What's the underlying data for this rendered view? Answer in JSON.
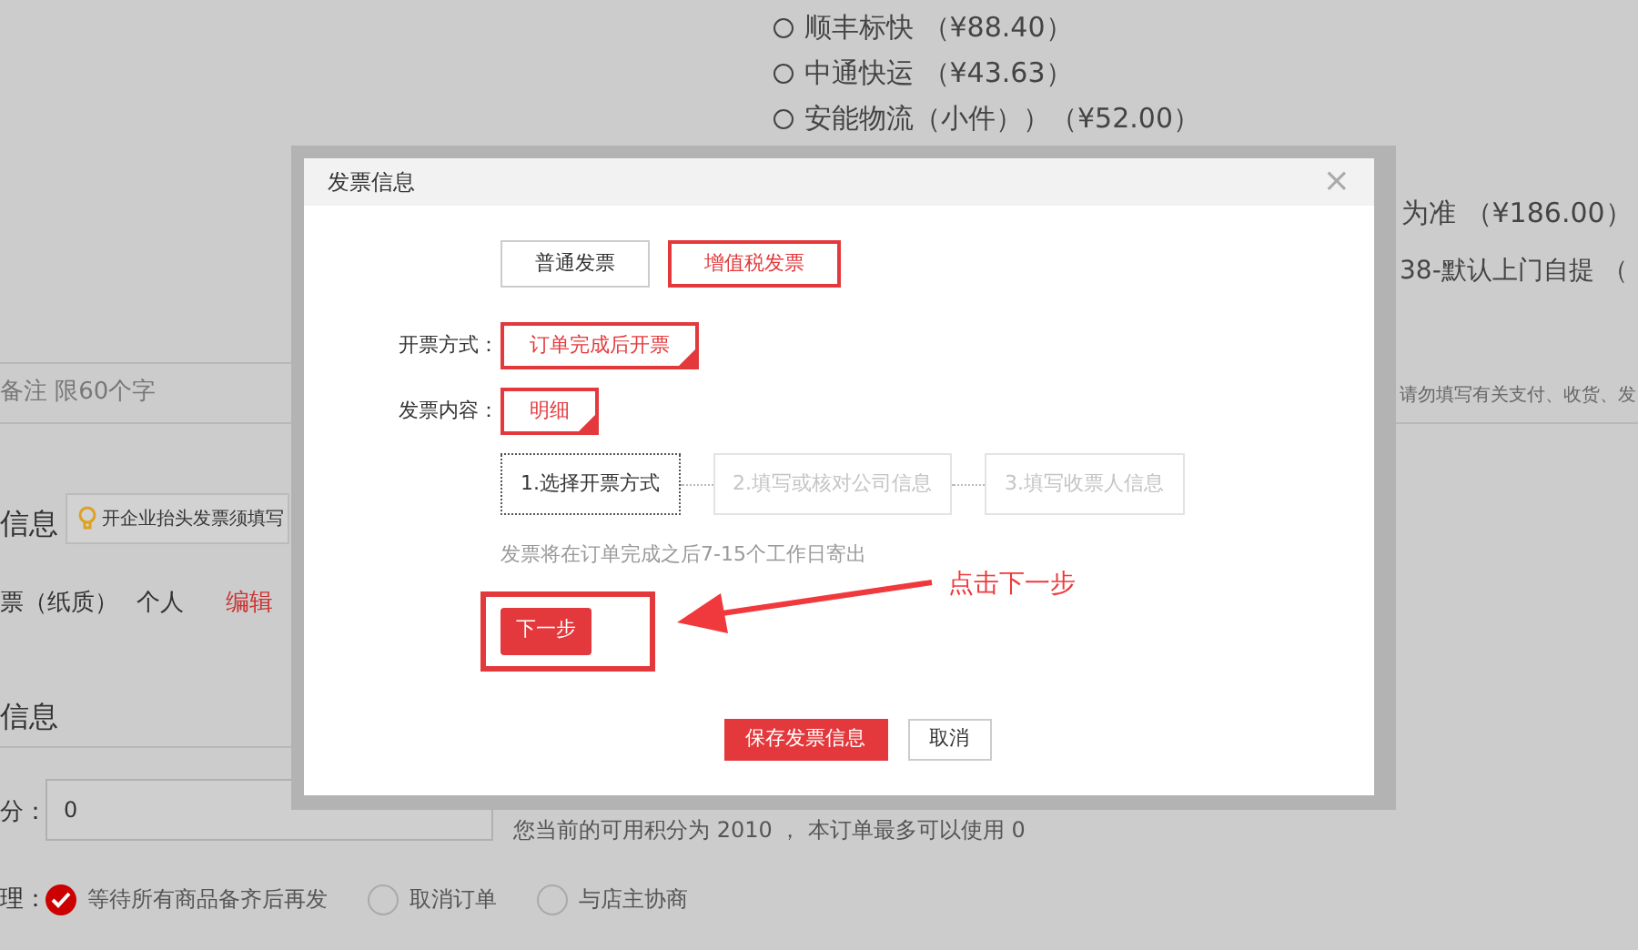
{
  "background": {
    "shipping_options": [
      {
        "label": "顺丰标快 （¥88.40）",
        "selected": false
      },
      {
        "label": "中通快运 （¥43.63）",
        "selected": false
      },
      {
        "label": "安能物流（小件））（¥52.00）",
        "selected": false
      }
    ],
    "price_note": "为准 （¥186.00）",
    "pickup_note": "38-默认上门自提 （",
    "remark_placeholder": "备注 限60个字",
    "remark_hint": "请勿填写有关支付、收货、发",
    "invoice_section_title": "信息",
    "invoice_tip": "开企业抬头发票须填写",
    "invoice_summary": {
      "type": "票（纸质）",
      "title": "个人",
      "edit_link": "编辑"
    },
    "points_section_title": "信息",
    "points_label": "分：",
    "points_value": "0",
    "points_note": "您当前的可用积分为 2010 ， 本订单最多可以使用 0",
    "stock_label": "理：",
    "stock_options": [
      {
        "label": "等待所有商品备齐后再发",
        "selected": true
      },
      {
        "label": "取消订单",
        "selected": false
      },
      {
        "label": "与店主协商",
        "selected": false
      }
    ]
  },
  "dialog": {
    "title": "发票信息",
    "close": "×",
    "invoice_types": [
      {
        "label": "普通发票",
        "selected": false
      },
      {
        "label": "增值税发票",
        "selected": true
      }
    ],
    "fields": [
      {
        "label": "开票方式：",
        "value": "订单完成后开票"
      },
      {
        "label": "发票内容：",
        "value": "明细"
      }
    ],
    "steps": [
      {
        "label": "1.选择开票方式",
        "active": true
      },
      {
        "label": "2.填写或核对公司信息",
        "active": false
      },
      {
        "label": "3.填写收票人信息",
        "active": false
      }
    ],
    "note": "发票将在订单完成之后7-15个工作日寄出",
    "next_button": "下一步",
    "save_button": "保存发票信息",
    "cancel_button": "取消"
  },
  "annotation": {
    "text": "点击下一步"
  }
}
